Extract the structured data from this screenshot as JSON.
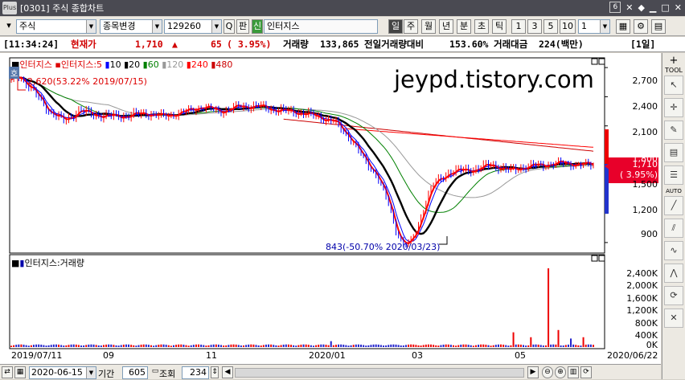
{
  "window": {
    "title": "[0301] 주식 종합차트",
    "win_count": "6",
    "ctrl_icons": [
      "pin-icon",
      "restore-icon",
      "minimize-icon",
      "close-icon"
    ]
  },
  "toolbar": {
    "market": "주식",
    "change_btn": "종목변경",
    "code": "129260",
    "pan": "판",
    "sin": "신",
    "name": "인터지스",
    "periods": [
      "일",
      "주",
      "월",
      "년",
      "분",
      "초",
      "틱"
    ],
    "selected_period": "일",
    "nums": [
      "1",
      "3",
      "5",
      "10"
    ],
    "num_value": "1"
  },
  "info": {
    "time": "[11:34:24]",
    "price_label": "현재가",
    "price": "1,710",
    "change": "65",
    "change_pct": "( 3.95%)",
    "vol_label": "거래량",
    "volume": "133,865",
    "prev_label": "전일거래량대비",
    "prev_pct": "153.60%",
    "amt_label": "거래대금",
    "amount": "224(백만)",
    "period_tag": "[1일]"
  },
  "price_chart": {
    "legend_name": "인터지스",
    "legend_ma": "인터지스:5",
    "ma_list": [
      {
        "label": "10",
        "color": "#0000ff"
      },
      {
        "label": "20",
        "color": "#000000"
      },
      {
        "label": "60",
        "color": "#008000"
      },
      {
        "label": "120",
        "color": "#999999"
      },
      {
        "label": "240",
        "color": "#ff0000"
      },
      {
        "label": "480",
        "color": "#cc0000"
      }
    ],
    "ho_badge": "호",
    "high_note": "2,620(53.22% 2019/07/15)",
    "low_note": "843(-50.70% 2020/03/23)",
    "watermark": "jeypd.tistory.com",
    "y_ticks": [
      "2,700",
      "2,400",
      "2,100",
      "1,800",
      "1,500",
      "1,200",
      "900"
    ],
    "current_price": "1,710",
    "current_pct": "( 3.95%)"
  },
  "volume_chart": {
    "legend": "인터지스:거래량",
    "y_ticks": [
      "2,400K",
      "2,000K",
      "1,600K",
      "1,200K",
      "800K",
      "400K",
      "0K"
    ]
  },
  "x_axis": {
    "dates": [
      "2019/07/11",
      "09",
      "11",
      "2020/01",
      "03",
      "05",
      "2020/06/22"
    ]
  },
  "bottom": {
    "date": "2020-06-15",
    "period_label": "기간",
    "period_val": "605",
    "view_label": "조회",
    "view_val": "234"
  },
  "sidebar": {
    "tool_label": "TOOL",
    "auto_label": "AUTO"
  },
  "chart_data": {
    "type": "line",
    "title": "",
    "xlabel": "",
    "ylabel": "",
    "ylim": [
      800,
      2800
    ],
    "x": [
      "2019/07/11",
      "2019/09",
      "2019/11",
      "2020/01",
      "2020/03",
      "2020/05",
      "2020/06/22"
    ],
    "series": [
      {
        "name": "인터지스",
        "values": [
          2560,
          2300,
          2250,
          2270,
          2200,
          843,
          1500,
          1720,
          1710
        ]
      }
    ],
    "annotations": [
      {
        "text": "2,620(53.22% 2019/07/15)",
        "y": 2620
      },
      {
        "text": "843(-50.70% 2020/03/23)",
        "y": 843
      }
    ]
  }
}
